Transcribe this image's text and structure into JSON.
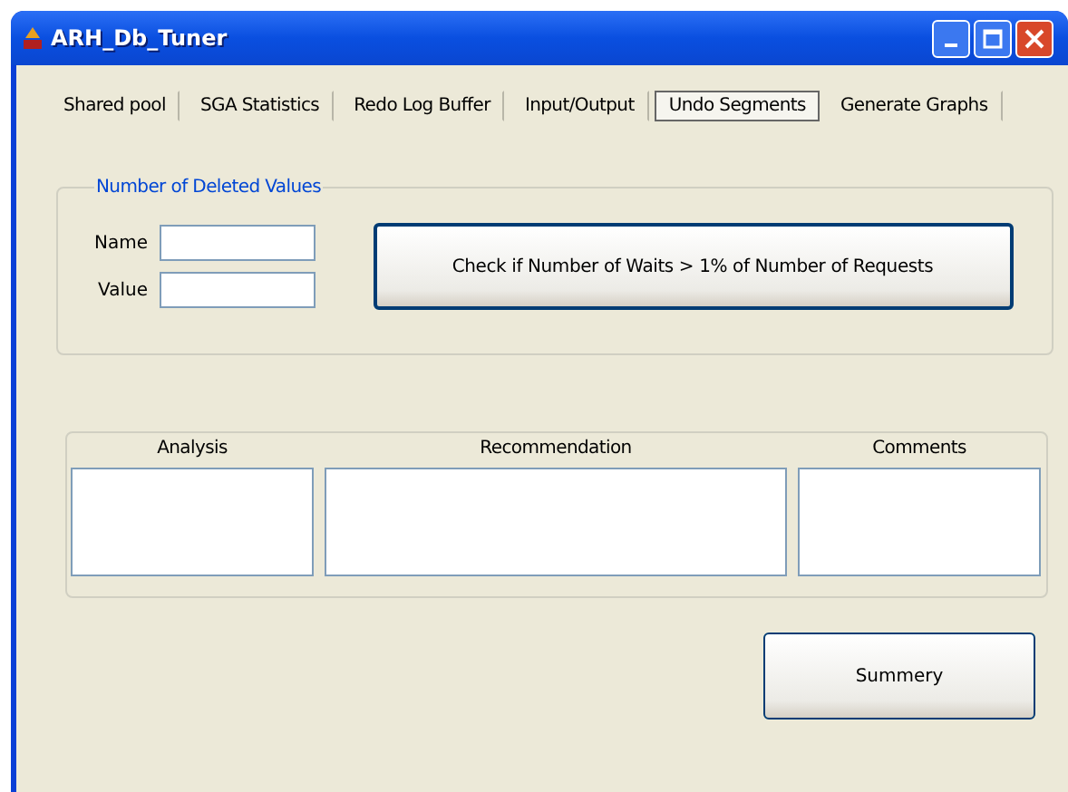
{
  "window": {
    "title": "ARH_Db_Tuner"
  },
  "tabs": [
    {
      "label": "Shared pool",
      "selected": false
    },
    {
      "label": "SGA Statistics",
      "selected": false
    },
    {
      "label": "Redo Log Buffer",
      "selected": false
    },
    {
      "label": "Input/Output",
      "selected": false
    },
    {
      "label": "Undo Segments",
      "selected": true
    },
    {
      "label": "Generate Graphs",
      "selected": false
    }
  ],
  "group": {
    "title": "Number of Deleted Values",
    "fields": [
      {
        "label": "Name"
      },
      {
        "label": "Value"
      }
    ],
    "button": "Check if Number of Waits > 1% of Number of Requests"
  },
  "results": [
    {
      "heading": "Analysis"
    },
    {
      "heading": "Recommendation"
    },
    {
      "heading": "Comments"
    }
  ],
  "summary_button": "Summery"
}
